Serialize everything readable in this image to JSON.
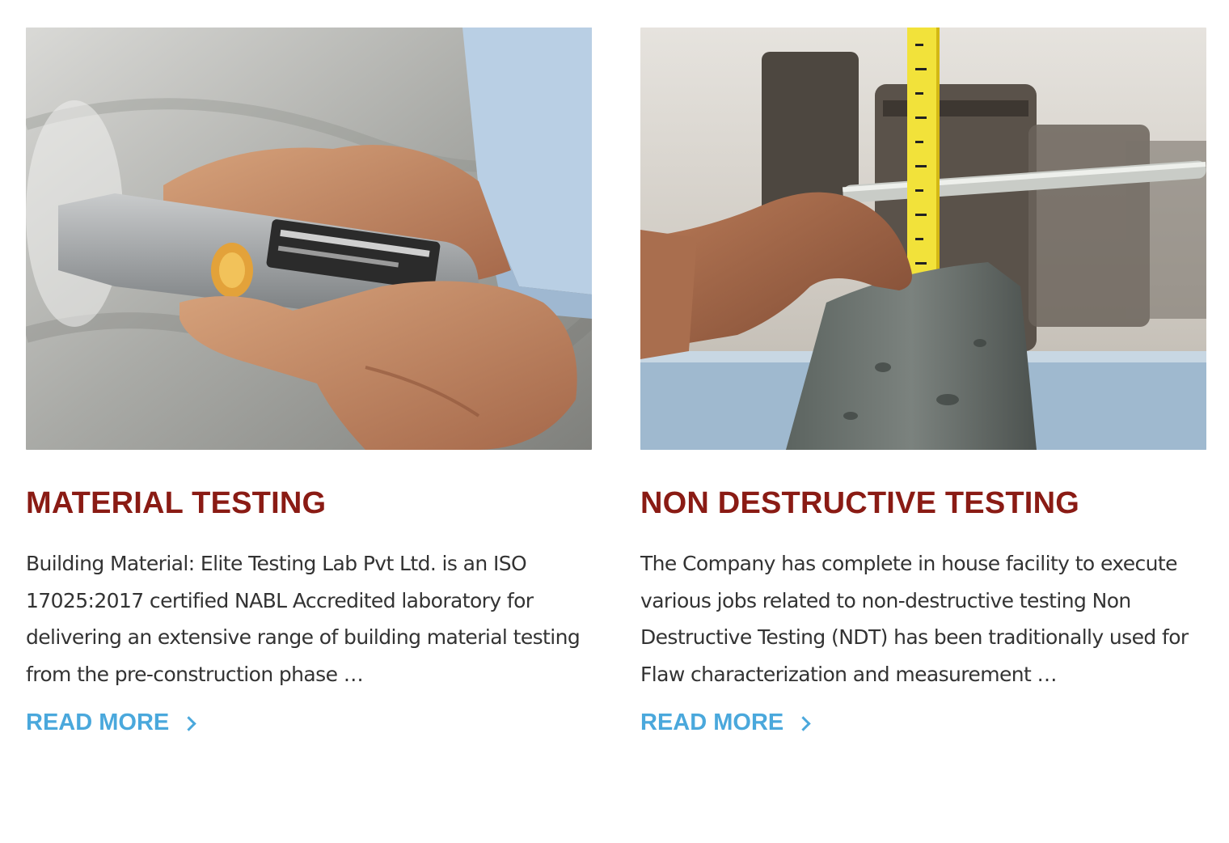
{
  "cards": [
    {
      "title": "MATERIAL TESTING",
      "description": "Building Material: Elite Testing Lab Pvt Ltd. is an ISO 17025:2017 certified NABL Accredited laboratory for delivering an extensive range of building material testing from the pre-construction phase …",
      "read_more": "READ MORE",
      "image": "rebound-hammer-on-concrete-wall"
    },
    {
      "title": "NON DESTRUCTIVE TESTING",
      "description": "The Company has complete in house facility to execute various jobs related to non-destructive testing Non Destructive Testing (NDT) has been traditionally used for Flaw characterization and measurement …",
      "read_more": "READ MORE",
      "image": "concrete-slump-test-with-measuring-tape"
    }
  ],
  "colors": {
    "title": "#8a1b14",
    "body_text": "#333333",
    "link": "#4aa8dc",
    "background": "#ffffff"
  },
  "icons": {
    "read_more": "chevron-right-icon"
  }
}
